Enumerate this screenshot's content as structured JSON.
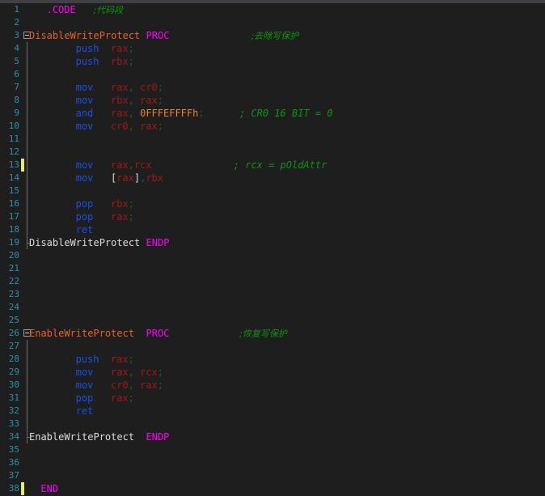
{
  "editor": {
    "app": "code-editor",
    "language": "masm-assembly",
    "theme": {
      "background": "#1e1e1e",
      "gutter_text": "#2b91af",
      "top_strip": "#3f4145",
      "directive": "#ff00ff",
      "keyword": "#1a4fe8",
      "label": "#e8622a",
      "register": "#a01818",
      "punctuation": "#0c6b0c",
      "number": "#e8833a",
      "comment": "#109410",
      "plain_text": "#dcdcdc",
      "change_marker": "#e8e87a",
      "fold_guide": "#6d6d6d"
    },
    "first_line_number": 1,
    "last_line_number": 38,
    "total_lines": 38
  },
  "lines": [
    {
      "n": "1",
      "marker": false,
      "fold": "none",
      "guide": "none",
      "indent": 3,
      "tokens": [
        {
          "t": ".CODE",
          "c": "tok-directive"
        },
        {
          "t": "   ",
          "c": "tok-plain"
        },
        {
          "t": ";代码段",
          "c": "tok-comment-cn"
        }
      ]
    },
    {
      "n": "2",
      "marker": false,
      "fold": "none",
      "guide": "none",
      "indent": 0,
      "tokens": []
    },
    {
      "n": "3",
      "marker": false,
      "fold": "collapse",
      "guide": "none",
      "indent": 0,
      "tokens": [
        {
          "t": "DisableWriteProtect",
          "c": "tok-label"
        },
        {
          "t": " ",
          "c": "tok-plain"
        },
        {
          "t": "PROC",
          "c": "tok-directive"
        },
        {
          "t": "              ",
          "c": "tok-plain"
        },
        {
          "t": ";去除写保护",
          "c": "tok-comment-cn"
        }
      ]
    },
    {
      "n": "4",
      "marker": false,
      "fold": "none",
      "guide": "line",
      "indent": 8,
      "tokens": [
        {
          "t": "push",
          "c": "tok-keyword"
        },
        {
          "t": "  ",
          "c": "tok-plain"
        },
        {
          "t": "rax",
          "c": "tok-reg"
        },
        {
          "t": ";",
          "c": "tok-punct"
        }
      ]
    },
    {
      "n": "5",
      "marker": false,
      "fold": "none",
      "guide": "line",
      "indent": 8,
      "tokens": [
        {
          "t": "push",
          "c": "tok-keyword"
        },
        {
          "t": "  ",
          "c": "tok-plain"
        },
        {
          "t": "rbx",
          "c": "tok-reg"
        },
        {
          "t": ";",
          "c": "tok-punct"
        }
      ]
    },
    {
      "n": "6",
      "marker": false,
      "fold": "none",
      "guide": "line",
      "indent": 0,
      "tokens": []
    },
    {
      "n": "7",
      "marker": false,
      "fold": "none",
      "guide": "line",
      "indent": 8,
      "tokens": [
        {
          "t": "mov",
          "c": "tok-keyword"
        },
        {
          "t": "   ",
          "c": "tok-plain"
        },
        {
          "t": "rax",
          "c": "tok-reg"
        },
        {
          "t": ", ",
          "c": "tok-punct"
        },
        {
          "t": "cr0",
          "c": "tok-reg"
        },
        {
          "t": ";",
          "c": "tok-punct"
        }
      ]
    },
    {
      "n": "8",
      "marker": false,
      "fold": "none",
      "guide": "line",
      "indent": 8,
      "tokens": [
        {
          "t": "mov",
          "c": "tok-keyword"
        },
        {
          "t": "   ",
          "c": "tok-plain"
        },
        {
          "t": "rbx",
          "c": "tok-reg"
        },
        {
          "t": ", ",
          "c": "tok-punct"
        },
        {
          "t": "rax",
          "c": "tok-reg"
        },
        {
          "t": ";",
          "c": "tok-punct"
        }
      ]
    },
    {
      "n": "9",
      "marker": false,
      "fold": "none",
      "guide": "line",
      "indent": 8,
      "tokens": [
        {
          "t": "and",
          "c": "tok-keyword"
        },
        {
          "t": "   ",
          "c": "tok-plain"
        },
        {
          "t": "rax",
          "c": "tok-reg"
        },
        {
          "t": ", ",
          "c": "tok-punct"
        },
        {
          "t": "0FFFEFFFFh",
          "c": "tok-num"
        },
        {
          "t": ";",
          "c": "tok-punct"
        },
        {
          "t": "      ",
          "c": "tok-plain"
        },
        {
          "t": "; CR0 16 BIT = 0",
          "c": "tok-comment"
        }
      ]
    },
    {
      "n": "10",
      "marker": false,
      "fold": "none",
      "guide": "line",
      "indent": 8,
      "tokens": [
        {
          "t": "mov",
          "c": "tok-keyword"
        },
        {
          "t": "   ",
          "c": "tok-plain"
        },
        {
          "t": "cr0",
          "c": "tok-reg"
        },
        {
          "t": ", ",
          "c": "tok-punct"
        },
        {
          "t": "rax",
          "c": "tok-reg"
        },
        {
          "t": ";",
          "c": "tok-punct"
        }
      ]
    },
    {
      "n": "11",
      "marker": false,
      "fold": "none",
      "guide": "line",
      "indent": 0,
      "tokens": []
    },
    {
      "n": "12",
      "marker": false,
      "fold": "none",
      "guide": "line",
      "indent": 0,
      "tokens": []
    },
    {
      "n": "13",
      "marker": true,
      "fold": "none",
      "guide": "line",
      "indent": 8,
      "tokens": [
        {
          "t": "mov",
          "c": "tok-keyword"
        },
        {
          "t": "   ",
          "c": "tok-plain"
        },
        {
          "t": "rax",
          "c": "tok-reg"
        },
        {
          "t": ",",
          "c": "tok-punct"
        },
        {
          "t": "rcx",
          "c": "tok-reg"
        },
        {
          "t": "              ",
          "c": "tok-plain"
        },
        {
          "t": "; rcx = pOldAttr",
          "c": "tok-comment"
        }
      ]
    },
    {
      "n": "14",
      "marker": false,
      "fold": "none",
      "guide": "line",
      "indent": 8,
      "tokens": [
        {
          "t": "mov",
          "c": "tok-keyword"
        },
        {
          "t": "   ",
          "c": "tok-plain"
        },
        {
          "t": "[",
          "c": "tok-bracket"
        },
        {
          "t": "rax",
          "c": "tok-reg"
        },
        {
          "t": "]",
          "c": "tok-bracket"
        },
        {
          "t": ",",
          "c": "tok-punct"
        },
        {
          "t": "rbx",
          "c": "tok-reg"
        }
      ]
    },
    {
      "n": "15",
      "marker": false,
      "fold": "none",
      "guide": "line",
      "indent": 0,
      "tokens": []
    },
    {
      "n": "16",
      "marker": false,
      "fold": "none",
      "guide": "line",
      "indent": 8,
      "tokens": [
        {
          "t": "pop",
          "c": "tok-keyword"
        },
        {
          "t": "   ",
          "c": "tok-plain"
        },
        {
          "t": "rbx",
          "c": "tok-reg"
        },
        {
          "t": ";",
          "c": "tok-punct"
        }
      ]
    },
    {
      "n": "17",
      "marker": false,
      "fold": "none",
      "guide": "line",
      "indent": 8,
      "tokens": [
        {
          "t": "pop",
          "c": "tok-keyword"
        },
        {
          "t": "   ",
          "c": "tok-plain"
        },
        {
          "t": "rax",
          "c": "tok-reg"
        },
        {
          "t": ";",
          "c": "tok-punct"
        }
      ]
    },
    {
      "n": "18",
      "marker": false,
      "fold": "none",
      "guide": "line",
      "indent": 8,
      "tokens": [
        {
          "t": "ret",
          "c": "tok-keyword"
        }
      ]
    },
    {
      "n": "19",
      "marker": false,
      "fold": "none",
      "guide": "end",
      "indent": 0,
      "tokens": [
        {
          "t": "DisableWriteProtect",
          "c": "tok-plain"
        },
        {
          "t": " ",
          "c": "tok-plain"
        },
        {
          "t": "ENDP",
          "c": "tok-directive"
        }
      ]
    },
    {
      "n": "20",
      "marker": false,
      "fold": "none",
      "guide": "none",
      "indent": 0,
      "tokens": []
    },
    {
      "n": "21",
      "marker": false,
      "fold": "none",
      "guide": "none",
      "indent": 0,
      "tokens": []
    },
    {
      "n": "22",
      "marker": false,
      "fold": "none",
      "guide": "none",
      "indent": 0,
      "tokens": []
    },
    {
      "n": "23",
      "marker": false,
      "fold": "none",
      "guide": "none",
      "indent": 0,
      "tokens": []
    },
    {
      "n": "24",
      "marker": false,
      "fold": "none",
      "guide": "none",
      "indent": 0,
      "tokens": []
    },
    {
      "n": "25",
      "marker": false,
      "fold": "none",
      "guide": "none",
      "indent": 0,
      "tokens": []
    },
    {
      "n": "26",
      "marker": false,
      "fold": "collapse",
      "guide": "none",
      "indent": 0,
      "tokens": [
        {
          "t": "EnableWriteProtect",
          "c": "tok-label"
        },
        {
          "t": "  ",
          "c": "tok-plain"
        },
        {
          "t": "PROC",
          "c": "tok-directive"
        },
        {
          "t": "            ",
          "c": "tok-plain"
        },
        {
          "t": ";恢复写保护",
          "c": "tok-comment-cn"
        }
      ]
    },
    {
      "n": "27",
      "marker": false,
      "fold": "none",
      "guide": "line",
      "indent": 0,
      "tokens": []
    },
    {
      "n": "28",
      "marker": false,
      "fold": "none",
      "guide": "line",
      "indent": 8,
      "tokens": [
        {
          "t": "push",
          "c": "tok-keyword"
        },
        {
          "t": "  ",
          "c": "tok-plain"
        },
        {
          "t": "rax",
          "c": "tok-reg"
        },
        {
          "t": ";",
          "c": "tok-punct"
        }
      ]
    },
    {
      "n": "29",
      "marker": false,
      "fold": "none",
      "guide": "line",
      "indent": 8,
      "tokens": [
        {
          "t": "mov",
          "c": "tok-keyword"
        },
        {
          "t": "   ",
          "c": "tok-plain"
        },
        {
          "t": "rax",
          "c": "tok-reg"
        },
        {
          "t": ", ",
          "c": "tok-punct"
        },
        {
          "t": "rcx",
          "c": "tok-reg"
        },
        {
          "t": ";",
          "c": "tok-punct"
        }
      ]
    },
    {
      "n": "30",
      "marker": false,
      "fold": "none",
      "guide": "line",
      "indent": 8,
      "tokens": [
        {
          "t": "mov",
          "c": "tok-keyword"
        },
        {
          "t": "   ",
          "c": "tok-plain"
        },
        {
          "t": "cr0",
          "c": "tok-reg"
        },
        {
          "t": ", ",
          "c": "tok-punct"
        },
        {
          "t": "rax",
          "c": "tok-reg"
        },
        {
          "t": ";",
          "c": "tok-punct"
        }
      ]
    },
    {
      "n": "31",
      "marker": false,
      "fold": "none",
      "guide": "line",
      "indent": 8,
      "tokens": [
        {
          "t": "pop",
          "c": "tok-keyword"
        },
        {
          "t": "   ",
          "c": "tok-plain"
        },
        {
          "t": "rax",
          "c": "tok-reg"
        },
        {
          "t": ";",
          "c": "tok-punct"
        }
      ]
    },
    {
      "n": "32",
      "marker": false,
      "fold": "none",
      "guide": "line",
      "indent": 8,
      "tokens": [
        {
          "t": "ret",
          "c": "tok-keyword"
        }
      ]
    },
    {
      "n": "33",
      "marker": false,
      "fold": "none",
      "guide": "line",
      "indent": 0,
      "tokens": []
    },
    {
      "n": "34",
      "marker": false,
      "fold": "none",
      "guide": "end",
      "indent": 0,
      "tokens": [
        {
          "t": "EnableWriteProtect",
          "c": "tok-plain"
        },
        {
          "t": "  ",
          "c": "tok-plain"
        },
        {
          "t": "ENDP",
          "c": "tok-directive"
        }
      ]
    },
    {
      "n": "35",
      "marker": false,
      "fold": "none",
      "guide": "none",
      "indent": 0,
      "tokens": []
    },
    {
      "n": "36",
      "marker": false,
      "fold": "none",
      "guide": "none",
      "indent": 0,
      "tokens": []
    },
    {
      "n": "37",
      "marker": false,
      "fold": "none",
      "guide": "none",
      "indent": 0,
      "tokens": []
    },
    {
      "n": "38",
      "marker": true,
      "fold": "none",
      "guide": "none",
      "indent": 2,
      "tokens": [
        {
          "t": "END",
          "c": "tok-directive"
        }
      ]
    }
  ]
}
